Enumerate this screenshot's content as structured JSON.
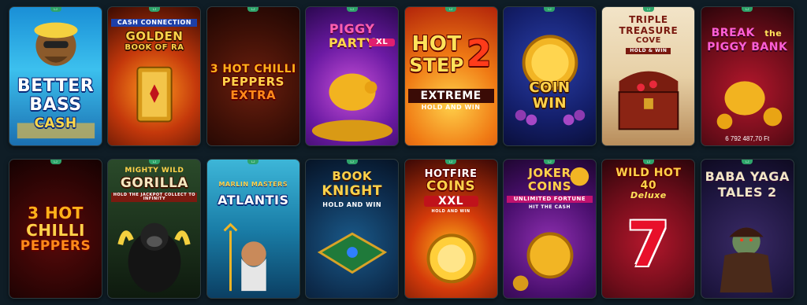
{
  "badge_label": "LJ",
  "games": [
    {
      "title": "BETTER BASS CASH",
      "line1": "BETTER",
      "line2": "BASS",
      "line3": "CASH"
    },
    {
      "title": "CASH CONNECTION GOLDEN BOOK OF RA",
      "line1": "CASH CONNECTION",
      "line2": "GOLDEN",
      "line3": "BOOK OF RA"
    },
    {
      "title": "3 HOT CHILLI PEPPERS EXTRA",
      "line1": "3 HOT CHILLI",
      "line2": "PEPPERS",
      "line3": "EXTRA"
    },
    {
      "title": "PIGGY PARTY XL",
      "line1": "PIGGY",
      "line2": "PARTY",
      "line3": "XL"
    },
    {
      "title": "HOT STEP 2 EXTREME",
      "line1": "HOT",
      "line2": "STEP",
      "line3": "2",
      "line4": "EXTREME",
      "line5": "HOLD AND WIN"
    },
    {
      "title": "COIN WIN",
      "line1": "COIN",
      "line2": "WIN"
    },
    {
      "title": "TRIPLE TREASURE COVE",
      "line1": "TRIPLE",
      "line2": "TREASURE",
      "line3": "COVE",
      "line4": "HOLD & WIN"
    },
    {
      "title": "BREAK the PIGGY BANK",
      "line1": "BREAK",
      "line2": "the",
      "line3": "PIGGY BANK",
      "jackpot": "6 792 487,70 Ft"
    },
    {
      "title": "3 HOT CHILLI PEPPERS",
      "line1": "3 HOT",
      "line2": "CHILLI",
      "line3": "PEPPERS"
    },
    {
      "title": "MIGHTY WILD GORILLA",
      "line1": "MIGHTY WILD",
      "line2": "GORILLA",
      "line3": "HOLD THE JACKPOT COLLECT TO INFINITY"
    },
    {
      "title": "MARLIN MASTERS ATLANTIS",
      "line1": "MARLIN MASTERS",
      "line2": "ATLANTIS"
    },
    {
      "title": "BOOK OF KNIGHT HOLD AND WIN",
      "line1": "BOOK",
      "line2": "KNIGHT",
      "line3": "HOLD AND WIN"
    },
    {
      "title": "HOTFIRE COINS XXL",
      "line1": "HOTFIRE",
      "line2": "COINS",
      "line3": "XXL",
      "line4": "HOLD AND WIN"
    },
    {
      "title": "JOKER COINS UNLIMITED FORTUNE",
      "line1": "JOKER",
      "line2": "COINS",
      "line3": "UNLIMITED FORTUNE",
      "line4": "HIT THE CASH"
    },
    {
      "title": "WILD HOT 40 Deluxe",
      "line1": "WILD HOT",
      "line2": "40",
      "line3": "Deluxe",
      "line4": "7"
    },
    {
      "title": "BABA YAGA TALES 2",
      "line1": "BABA YAGA",
      "line2": "TALES 2"
    }
  ],
  "colors": {
    "page_bg": "#0f1d26",
    "badge": "#2ea36a"
  }
}
